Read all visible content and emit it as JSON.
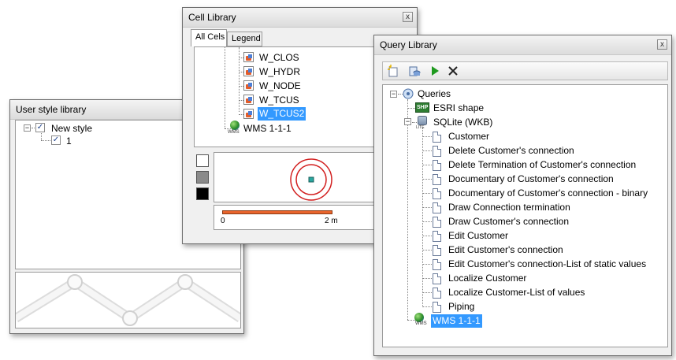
{
  "user_style": {
    "title": "User style library",
    "close": "x",
    "root_label": "New style",
    "child_label": "1"
  },
  "cell_library": {
    "title": "Cell Library",
    "close": "x",
    "tabs": [
      "All Cels",
      "Legend"
    ],
    "items": [
      "W_CLOS",
      "W_HYDR",
      "W_NODE",
      "W_TCUS",
      "W_TCUS2"
    ],
    "selected_item": "W_TCUS2",
    "wms_label": "WMS 1-1-1",
    "wms_icon_text": "WMS",
    "scale": {
      "start": "0",
      "end": "2 m"
    },
    "colors": {
      "scale_bar": "#e8642c",
      "circle": "#d21f1f",
      "center": "#2aa7a0"
    }
  },
  "query_library": {
    "title": "Query Library",
    "close": "x",
    "toolbar": [
      "new-query-icon",
      "database-query-icon",
      "run-icon",
      "delete-icon"
    ],
    "root_label": "Queries",
    "esri_label": "ESRI shape",
    "esri_icon_text": "SHP",
    "sqlite_label": "SQLite (WKB)",
    "sqlite_icon_text": "LITE",
    "queries": [
      "Customer",
      "Delete Customer's connection",
      "Delete Termination of Customer's connection",
      "Documentary of Customer's connection",
      "Documentary of Customer's connection - binary",
      "Draw Connection termination",
      "Draw Customer's connection",
      "Edit Customer",
      "Edit Customer's connection",
      "Edit Customer's connection-List of static values",
      "Localize Customer",
      "Localize Customer-List of values",
      "Piping"
    ],
    "wms_label": "WMS 1-1-1",
    "wms_icon_text": "WMS",
    "colors": {
      "selection": "#3399ff"
    }
  }
}
